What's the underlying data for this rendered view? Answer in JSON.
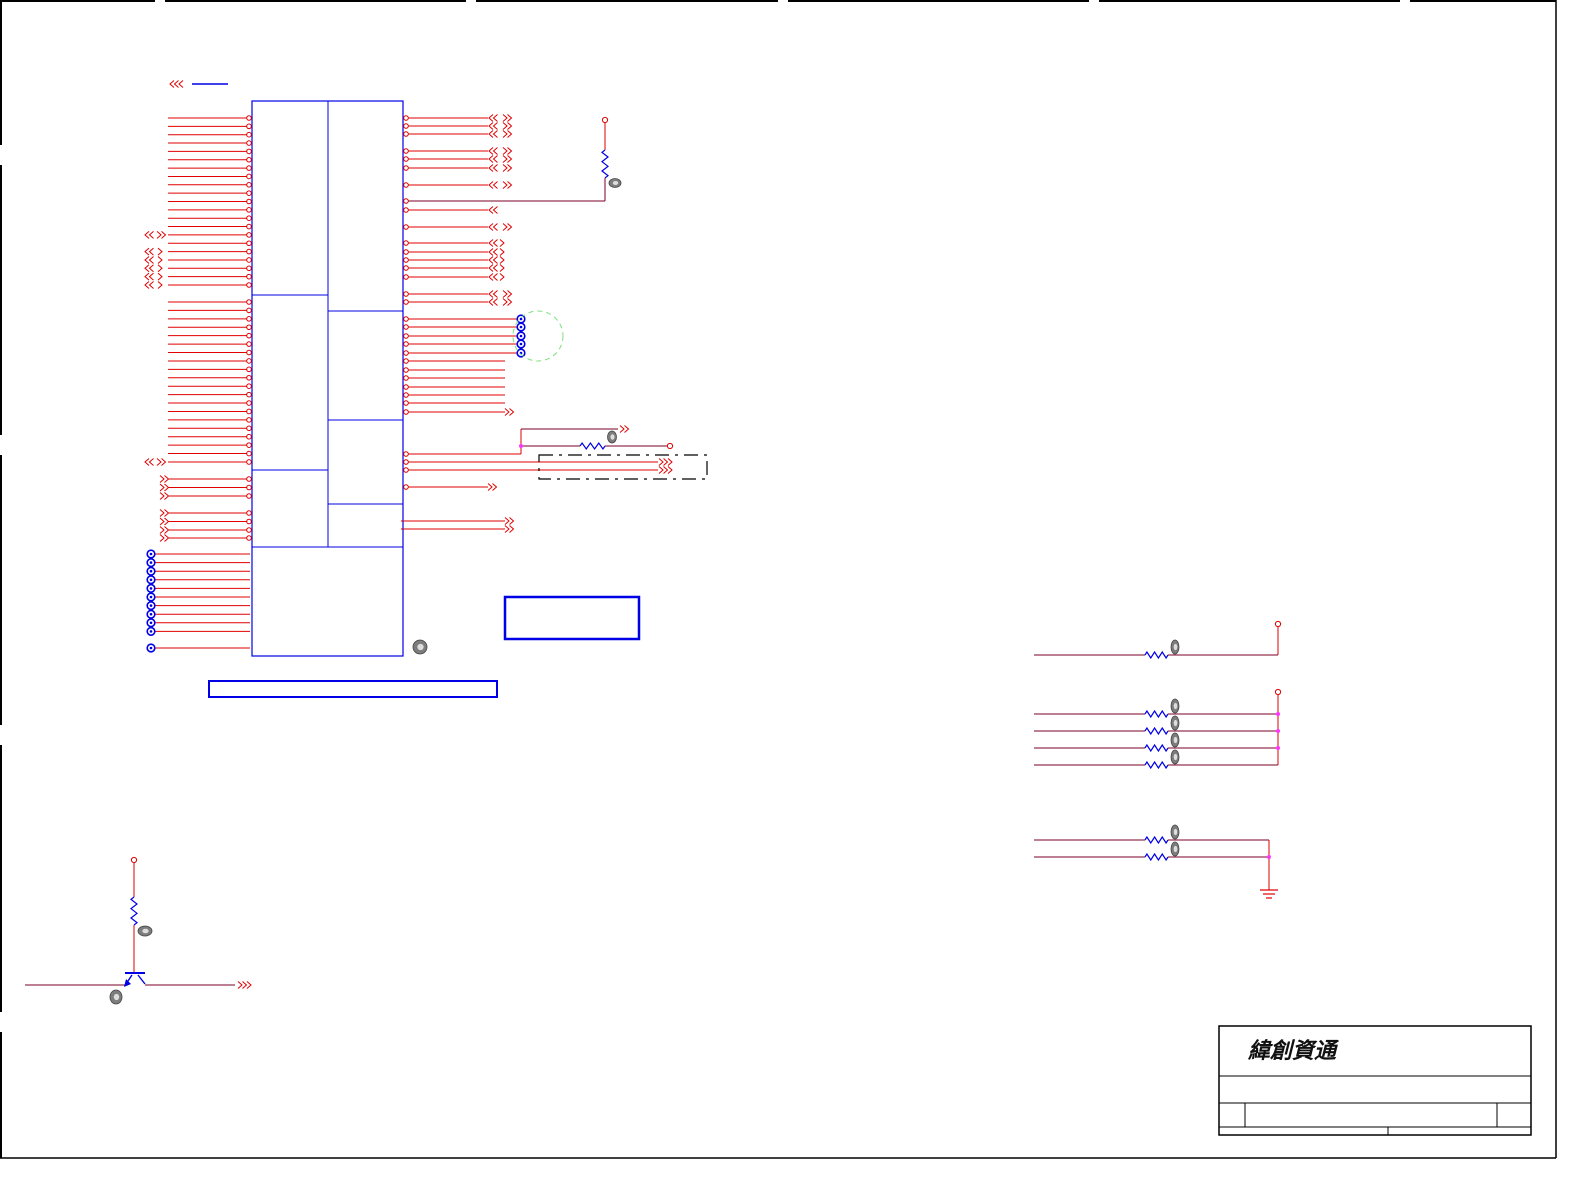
{
  "title_block": {
    "company": "緯創資通"
  },
  "colors": {
    "wire": "#e00000",
    "net": "#7a0026",
    "component": "#0000e6",
    "junction": "#ff33ff",
    "frame": "#000000",
    "marker": "#7d7d7d",
    "keepout": "#7fe07f"
  },
  "symbols": {
    "marker": "marker-icon",
    "resistor": "resistor-icon",
    "test_point": "test-point-icon",
    "ground": "ground-icon",
    "transistor": "transistor-icon",
    "offpage_arrow": "offpage-arrow-icon"
  }
}
